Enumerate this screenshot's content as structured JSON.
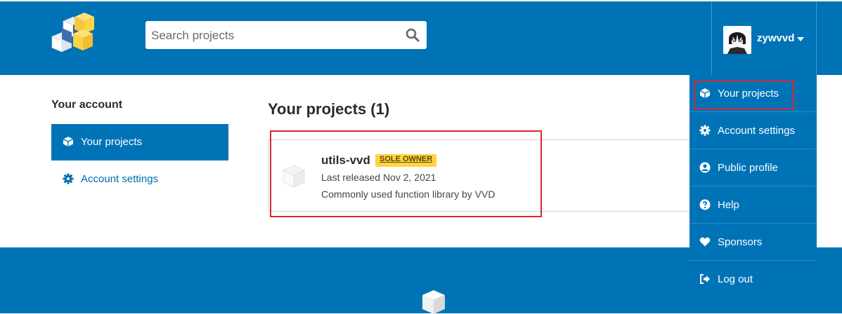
{
  "header": {
    "search_placeholder": "Search projects",
    "username": "zywvvd"
  },
  "sidebar": {
    "heading": "Your account",
    "items": [
      {
        "label": "Your projects",
        "icon": "cube-icon",
        "active": true
      },
      {
        "label": "Account settings",
        "icon": "gear-icon",
        "active": false
      }
    ]
  },
  "main": {
    "title": "Your projects (1)",
    "projects": [
      {
        "name": "utils-vvd",
        "badge": "SOLE OWNER",
        "released": "Last released Nov 2, 2021",
        "description": "Commonly used function library by VVD"
      }
    ]
  },
  "dropdown": {
    "items": [
      {
        "label": "Your projects",
        "icon": "cube-icon"
      },
      {
        "label": "Account settings",
        "icon": "gear-icon"
      },
      {
        "label": "Public profile",
        "icon": "user-circle-icon"
      },
      {
        "label": "Help",
        "icon": "question-circle-icon"
      },
      {
        "label": "Sponsors",
        "icon": "heart-icon"
      },
      {
        "label": "Log out",
        "icon": "sign-out-icon"
      }
    ]
  },
  "colors": {
    "brand_blue": "#0073b7",
    "badge_yellow": "#ffd343",
    "highlight_red": "#d9262c"
  }
}
